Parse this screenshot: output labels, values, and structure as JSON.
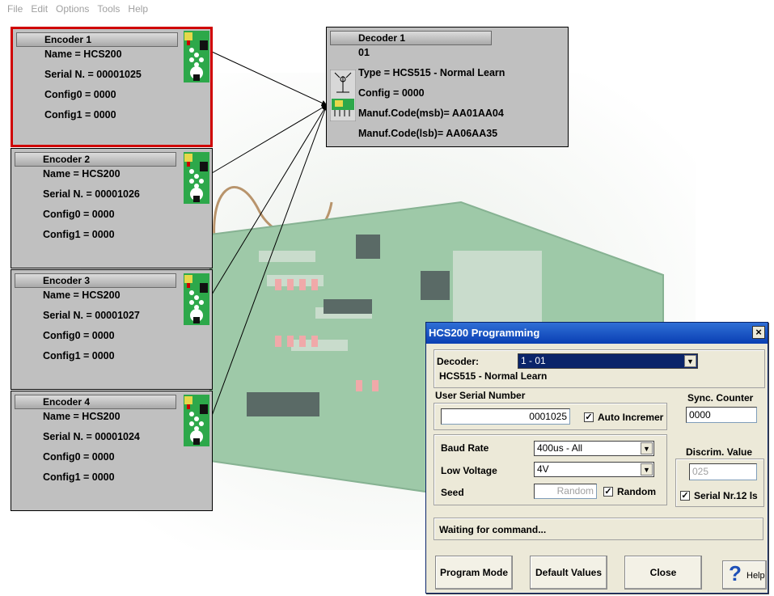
{
  "menu": [
    "File",
    "Edit",
    "Options",
    "Tools",
    "Help"
  ],
  "encoders": [
    {
      "title": "Encoder 1",
      "name": "Name = HCS200",
      "serial": "Serial N. = 00001025",
      "config0": "Config0 = 0000",
      "config1": "Config1 = 0000"
    },
    {
      "title": "Encoder 2",
      "name": "Name = HCS200",
      "serial": "Serial N. = 00001026",
      "config0": "Config0 = 0000",
      "config1": "Config1 = 0000"
    },
    {
      "title": "Encoder 3",
      "name": "Name = HCS200",
      "serial": "Serial N. = 00001027",
      "config0": "Config0 = 0000",
      "config1": "Config1 = 0000"
    },
    {
      "title": "Encoder 4",
      "name": "Name = HCS200",
      "serial": "Serial N. = 00001024",
      "config0": "Config0 = 0000",
      "config1": "Config1 = 0000"
    }
  ],
  "decoder": {
    "title": "Decoder 1",
    "id": "01",
    "type": "Type = HCS515 - Normal Learn",
    "config": "Config = 0000",
    "manuf_msb": "Manuf.Code(msb)= AA01AA04",
    "manuf_lsb": "Manuf.Code(lsb)= AA06AA35"
  },
  "dialog": {
    "title": "HCS200 Programming",
    "close_glyph": "×",
    "decoder_label": "Decoder:",
    "decoder_value": "1 - 01",
    "decoder_type": "HCS515 - Normal Learn",
    "user_serial_label": "User Serial Number",
    "user_serial_value": "0001025",
    "auto_increment_label": "Auto Incremer",
    "auto_increment_checked": true,
    "sync_counter_label": "Sync. Counter",
    "sync_counter_value": "0000",
    "baud_rate_label": "Baud Rate",
    "baud_rate_value": "400us - All",
    "low_voltage_label": "Low Voltage",
    "low_voltage_value": "4V",
    "seed_label": "Seed",
    "seed_value": "Random",
    "random_label": "Random",
    "random_checked": true,
    "discrim_label": "Discrim. Value",
    "discrim_value": "025",
    "serial12_label": "Serial Nr.12 ls",
    "serial12_checked": true,
    "status": "Waiting for command...",
    "buttons": {
      "program": "Program Mode",
      "defaults": "Default Values",
      "close": "Close",
      "help": "Help"
    }
  },
  "colors": {
    "selected_border": "#d00000",
    "card_bg": "#c0c0c0",
    "titlebar": "#0a3fb3",
    "combo_highlight": "#0a246a"
  }
}
